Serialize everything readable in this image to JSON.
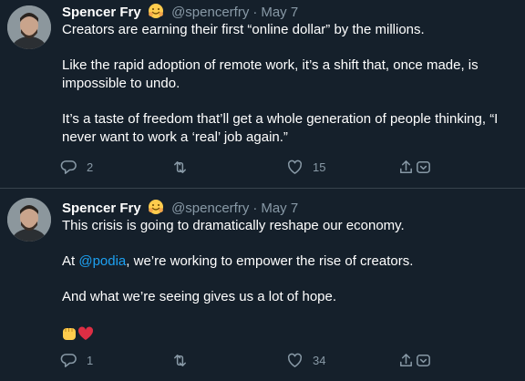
{
  "colors": {
    "background": "#15202b",
    "text": "#ffffff",
    "muted": "#8899a6",
    "link": "#1da1f2",
    "divider": "#38444d"
  },
  "tweets": [
    {
      "author_name": "Spencer Fry",
      "author_badge_icon": "hugging-face-icon",
      "handle": "@spencerfry",
      "separator": "·",
      "date": "May 7",
      "paragraphs": [
        "Creators are earning their first “online dollar” by the millions.",
        "Like the rapid adoption of remote work, it’s a shift that, once made, is impossible to undo.",
        "It’s a taste of freedom that’ll get a whole generation of people thinking, “I never want to work a ‘real’ job again.”"
      ],
      "actions": {
        "replies": "2",
        "retweets": "",
        "likes": "15"
      }
    },
    {
      "author_name": "Spencer Fry",
      "author_badge_icon": "hugging-face-icon",
      "handle": "@spencerfry",
      "separator": "·",
      "date": "May 7",
      "paragraphs": [
        "This crisis is going to dramatically reshape our economy.",
        "And what we’re seeing gives us a lot of hope."
      ],
      "mention_paragraph": {
        "before": "At ",
        "mention": "@podia",
        "after": ", we’re working to empower the rise of creators."
      },
      "emojis": [
        "raised-fist-icon",
        "red-heart-icon"
      ],
      "actions": {
        "replies": "1",
        "retweets": "",
        "likes": "34"
      }
    }
  ]
}
